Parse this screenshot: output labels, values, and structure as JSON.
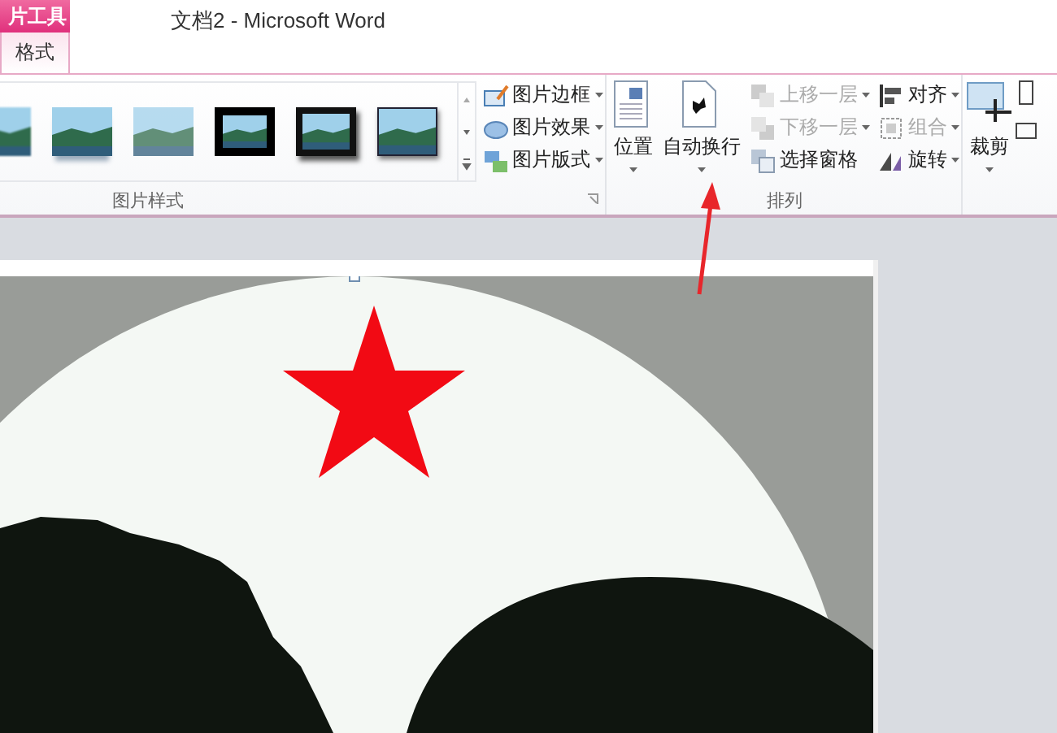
{
  "window": {
    "title": "文档2 - Microsoft Word"
  },
  "contextual_group": "片工具",
  "tabs": [
    {
      "label": "格式",
      "selected": true
    }
  ],
  "picture_styles": {
    "label": "图片样式",
    "gallery": [
      {
        "kind": "soft"
      },
      {
        "kind": "reflection"
      },
      {
        "kind": "faded"
      },
      {
        "kind": "double"
      },
      {
        "kind": "thick"
      },
      {
        "kind": "thin"
      }
    ],
    "commands": [
      {
        "label": "图片边框",
        "kind": "border"
      },
      {
        "label": "图片效果",
        "kind": "effects"
      },
      {
        "label": "图片版式",
        "kind": "layout"
      }
    ]
  },
  "arrange": {
    "label": "排列",
    "large": [
      {
        "label": "位置",
        "kind": "position"
      },
      {
        "label": "自动换行",
        "kind": "wrap"
      }
    ],
    "small": [
      {
        "label": "上移一层",
        "kind": "forward",
        "disabled": true
      },
      {
        "label": "下移一层",
        "kind": "backward",
        "disabled": true
      },
      {
        "label": "选择窗格",
        "kind": "pane",
        "disabled": false
      },
      {
        "label": "对齐",
        "kind": "align",
        "disabled": false
      },
      {
        "label": "组合",
        "kind": "group",
        "disabled": true
      },
      {
        "label": "旋转",
        "kind": "rotate",
        "disabled": false
      }
    ]
  },
  "size": {
    "large": [
      {
        "label": "裁剪",
        "kind": "crop"
      }
    ]
  }
}
